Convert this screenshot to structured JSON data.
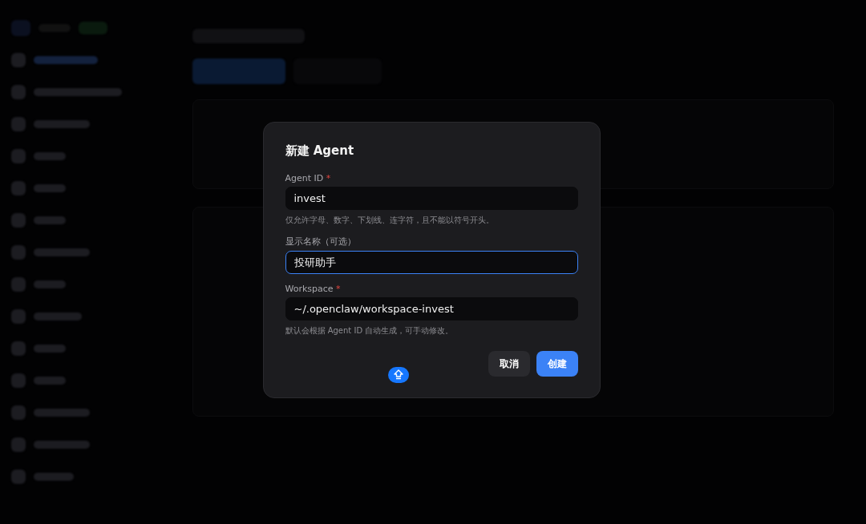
{
  "dialog": {
    "title": "新建 Agent",
    "fields": [
      {
        "label": "Agent ID",
        "required_mark": "*",
        "value": "invest",
        "focused": false,
        "hint": "仅允许字母、数字、下划线、连字符，且不能以符号开头。"
      },
      {
        "label": "显示名称（可选）",
        "value": "投研助手",
        "focused": true
      },
      {
        "label": "Workspace",
        "required_mark": "*",
        "value": "~/.openclaw/workspace-invest",
        "focused": false,
        "hint": "默认会根据 Agent ID 自动生成，可手动修改。"
      }
    ],
    "buttons": [
      {
        "label": "取消",
        "kind": "secondary"
      },
      {
        "label": "创建",
        "kind": "primary"
      }
    ]
  }
}
